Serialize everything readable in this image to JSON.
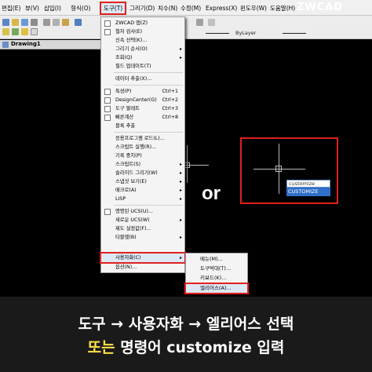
{
  "menubar": {
    "items": [
      "편집(E)",
      "뷰(V)",
      "삽입(I)",
      "형식(O)",
      "도구(T)",
      "그리기(D)",
      "치수(N)",
      "수정(M)",
      "Express(X)",
      "윈도우(W)",
      "도움말(H)"
    ]
  },
  "logo": {
    "brand": "ZWCAD"
  },
  "toolbar": {
    "layer_label": "ByLayer"
  },
  "drawing_tab": {
    "title": "Drawing1"
  },
  "tools_menu": {
    "items": [
      {
        "label": "ZWCAD 앱(Z)",
        "shortcut": "",
        "arrow": ""
      },
      {
        "label": "철자 검사(E)",
        "shortcut": "",
        "arrow": ""
      },
      {
        "label": "신속 선택(K)...",
        "shortcut": "",
        "arrow": ""
      },
      {
        "label": "그리기 순서(O)",
        "shortcut": "",
        "arrow": "▸"
      },
      {
        "label": "조회(Q)",
        "shortcut": "",
        "arrow": "▸"
      },
      {
        "label": "필드 업데이트(T)",
        "shortcut": "",
        "arrow": ""
      },
      {
        "label": "데이터 추출(X)...",
        "shortcut": "",
        "arrow": ""
      },
      {
        "label": "특성(P)",
        "shortcut": "Ctrl+1",
        "arrow": ""
      },
      {
        "label": "DesignCenter(G)",
        "shortcut": "Ctrl+2",
        "arrow": ""
      },
      {
        "label": "도구 팔레트",
        "shortcut": "Ctrl+3",
        "arrow": ""
      },
      {
        "label": "빠른계산",
        "shortcut": "Ctrl+8",
        "arrow": ""
      },
      {
        "label": "블록 추출",
        "shortcut": "",
        "arrow": ""
      },
      {
        "label": "응용프로그램 로드(L)...",
        "shortcut": "",
        "arrow": ""
      },
      {
        "label": "스크립트 실행(R)...",
        "shortcut": "",
        "arrow": ""
      },
      {
        "label": "기록 중지(P)",
        "shortcut": "",
        "arrow": ""
      },
      {
        "label": "스크립트(S)",
        "shortcut": "",
        "arrow": "▸"
      },
      {
        "label": "슬라이드 그리기(W)",
        "shortcut": "",
        "arrow": "▸"
      },
      {
        "label": "스냅샷 보기(E)",
        "shortcut": "",
        "arrow": "▸"
      },
      {
        "label": "매크로(A)",
        "shortcut": "",
        "arrow": "▸"
      },
      {
        "label": "LISP",
        "shortcut": "",
        "arrow": "▸"
      },
      {
        "label": "명명된 UCS(U)...",
        "shortcut": "",
        "arrow": ""
      },
      {
        "label": "새로운 UCS(W)",
        "shortcut": "",
        "arrow": "▸"
      },
      {
        "label": "제도 설정값(F)...",
        "shortcut": "",
        "arrow": ""
      },
      {
        "label": "타블렛(B)",
        "shortcut": "",
        "arrow": "▸"
      },
      {
        "label": "사용자화(C)",
        "shortcut": "",
        "arrow": "▸"
      },
      {
        "label": "옵션(N)...",
        "shortcut": "",
        "arrow": ""
      }
    ]
  },
  "customize_submenu": {
    "items": [
      "메뉴(M)...",
      "도구막대(T)...",
      "키보드(K)...",
      "엘리어스(A)..."
    ]
  },
  "or_label": "or",
  "command_input": {
    "value": "customize",
    "suggestion": "CUSTOMIZE"
  },
  "caption": {
    "line1": "도구 → 사용자화 → 엘리어스 선택",
    "line2_highlight": "또는",
    "line2_rest": " 명령어 customize 입력"
  }
}
